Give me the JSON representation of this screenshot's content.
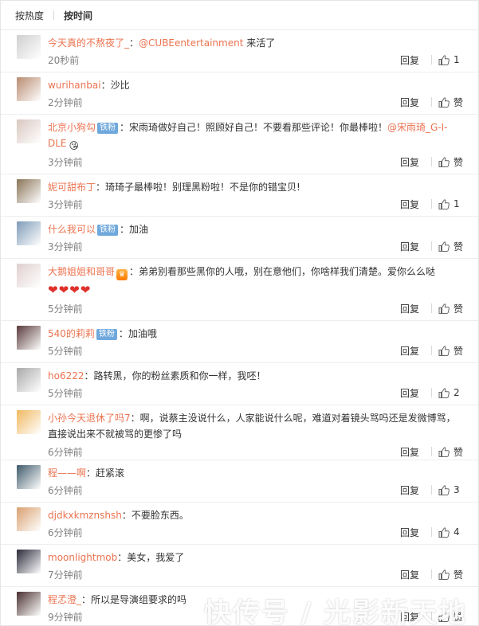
{
  "sort": {
    "hot": "按热度",
    "time": "按时间"
  },
  "reply_label": "回复",
  "comments": [
    {
      "user": "今天真的不熬夜了_",
      "badge": "",
      "text": "：",
      "mention": "@CUBEentertainment",
      "text2": " 来活了",
      "time": "20秒前",
      "likes": "1",
      "avatar_color": "#cfcfcf"
    },
    {
      "user": "wurihanbai",
      "badge": "",
      "text": "：沙比",
      "mention": "",
      "text2": "",
      "time": "2分钟前",
      "likes": "赞",
      "avatar_color": "#b88b70"
    },
    {
      "user": "北京小狗勾",
      "badge": "铁粉",
      "text": "：宋雨琦做好自己！照顾好自己！不要看那些评论！你最棒啦！",
      "mention": "@宋雨琦_G-I-DLE",
      "text2": "",
      "emoji": "😘",
      "time": "3分钟前",
      "likes": "赞",
      "avatar_color": "#d9c7c0"
    },
    {
      "user": "妮可甜布丁",
      "badge": "",
      "text": "：琦琦子最棒啦！别理黑粉啦！不是你的错宝贝!",
      "mention": "",
      "text2": "",
      "time": "3分钟前",
      "likes": "1",
      "avatar_color": "#8a7457"
    },
    {
      "user": "什么我可以",
      "badge": "铁粉",
      "text": "：加油",
      "mention": "",
      "text2": "",
      "time": "3分钟前",
      "likes": "赞",
      "avatar_color": "#7f9bb8"
    },
    {
      "user": "大鹅姐姐和哥哥",
      "badge": "",
      "crown": true,
      "text": "：弟弟别看那些黑你的人哦，别在意他们，你啥样我们清楚。爱你么么哒",
      "mention": "",
      "text2": "",
      "hearts": "❤❤❤❤",
      "time": "5分钟前",
      "likes": "赞",
      "avatar_color": "#e0cfcf"
    },
    {
      "user": "540的莉莉",
      "badge": "铁粉",
      "text": "：加油哦",
      "mention": "",
      "text2": "",
      "time": "5分钟前",
      "likes": "赞",
      "avatar_color": "#5a3a3a"
    },
    {
      "user": "ho6222",
      "badge": "",
      "text": "：路转黑，你的粉丝素质和你一样，我呸！",
      "mention": "",
      "text2": "",
      "time": "5分钟前",
      "likes": "2",
      "avatar_color": "#a9a9a9"
    },
    {
      "user": "小孙今天退休了吗7",
      "badge": "",
      "text": "：啊，说蔡主没说什么，人家能说什么呢，难道对着镜头骂吗还是发微博骂，直接说出来不就被骂的更惨了吗",
      "mention": "",
      "text2": "",
      "time": "6分钟前",
      "likes": "赞",
      "avatar_color": "#f0b860"
    },
    {
      "user": "程——啊",
      "badge": "",
      "text": "：赶紧滚",
      "mention": "",
      "text2": "",
      "time": "6分钟前",
      "likes": "3",
      "avatar_color": "#3f5a6a"
    },
    {
      "user": "djdkxkmznshsh",
      "badge": "",
      "text": "：不要脸东西。",
      "mention": "",
      "text2": "",
      "time": "6分钟前",
      "likes": "4",
      "avatar_color": "#d9a070"
    },
    {
      "user": "moonlightmob",
      "badge": "",
      "text": "：美女，我爱了",
      "mention": "",
      "text2": "",
      "time": "7分钟前",
      "likes": "赞",
      "avatar_color": "#2a2a3a"
    },
    {
      "user": "程孞澄_",
      "badge": "",
      "text": "：所以是导演组要求的吗",
      "mention": "",
      "text2": "",
      "time": "9分钟前",
      "likes": "赞",
      "avatar_color": "#4a3030"
    }
  ],
  "watermark": "快传号 / 光影新天地"
}
